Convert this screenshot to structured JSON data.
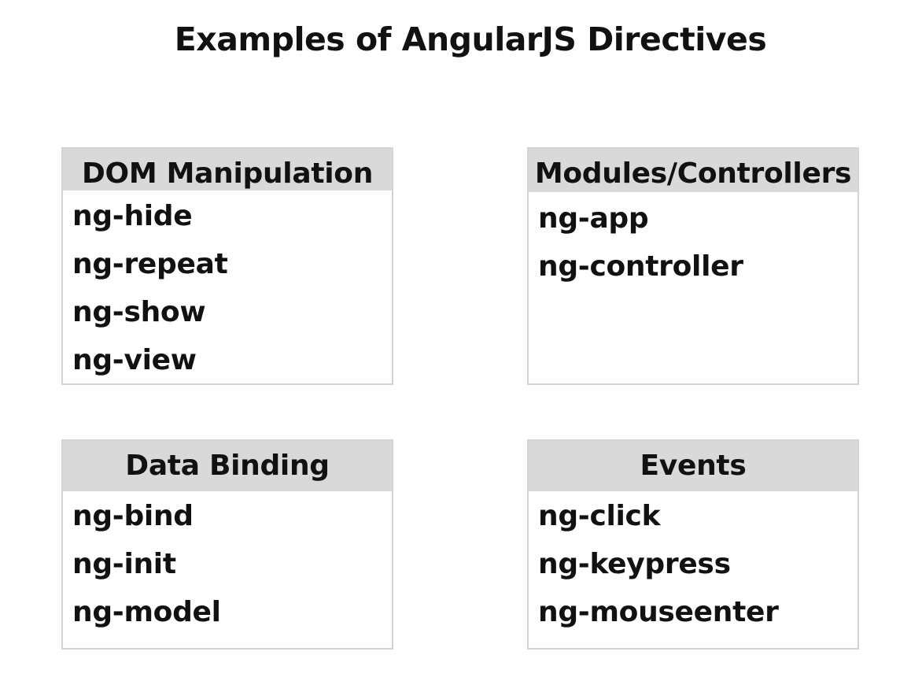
{
  "title": "Examples of AngularJS Directives",
  "groups": [
    {
      "name": "DOM Manipulation",
      "items": [
        "ng-hide",
        "ng-repeat",
        "ng-show",
        "ng-view"
      ]
    },
    {
      "name": "Modules/Controllers",
      "items": [
        "ng-app",
        "ng-controller"
      ]
    },
    {
      "name": "Data Binding",
      "items": [
        "ng-bind",
        "ng-init",
        "ng-model"
      ]
    },
    {
      "name": "Events",
      "items": [
        "ng-click",
        "ng-keypress",
        "ng-mouseenter"
      ]
    }
  ],
  "colors": {
    "header_background": "#d9d9d9",
    "border": "#d4d4d4",
    "text": "#111111"
  }
}
